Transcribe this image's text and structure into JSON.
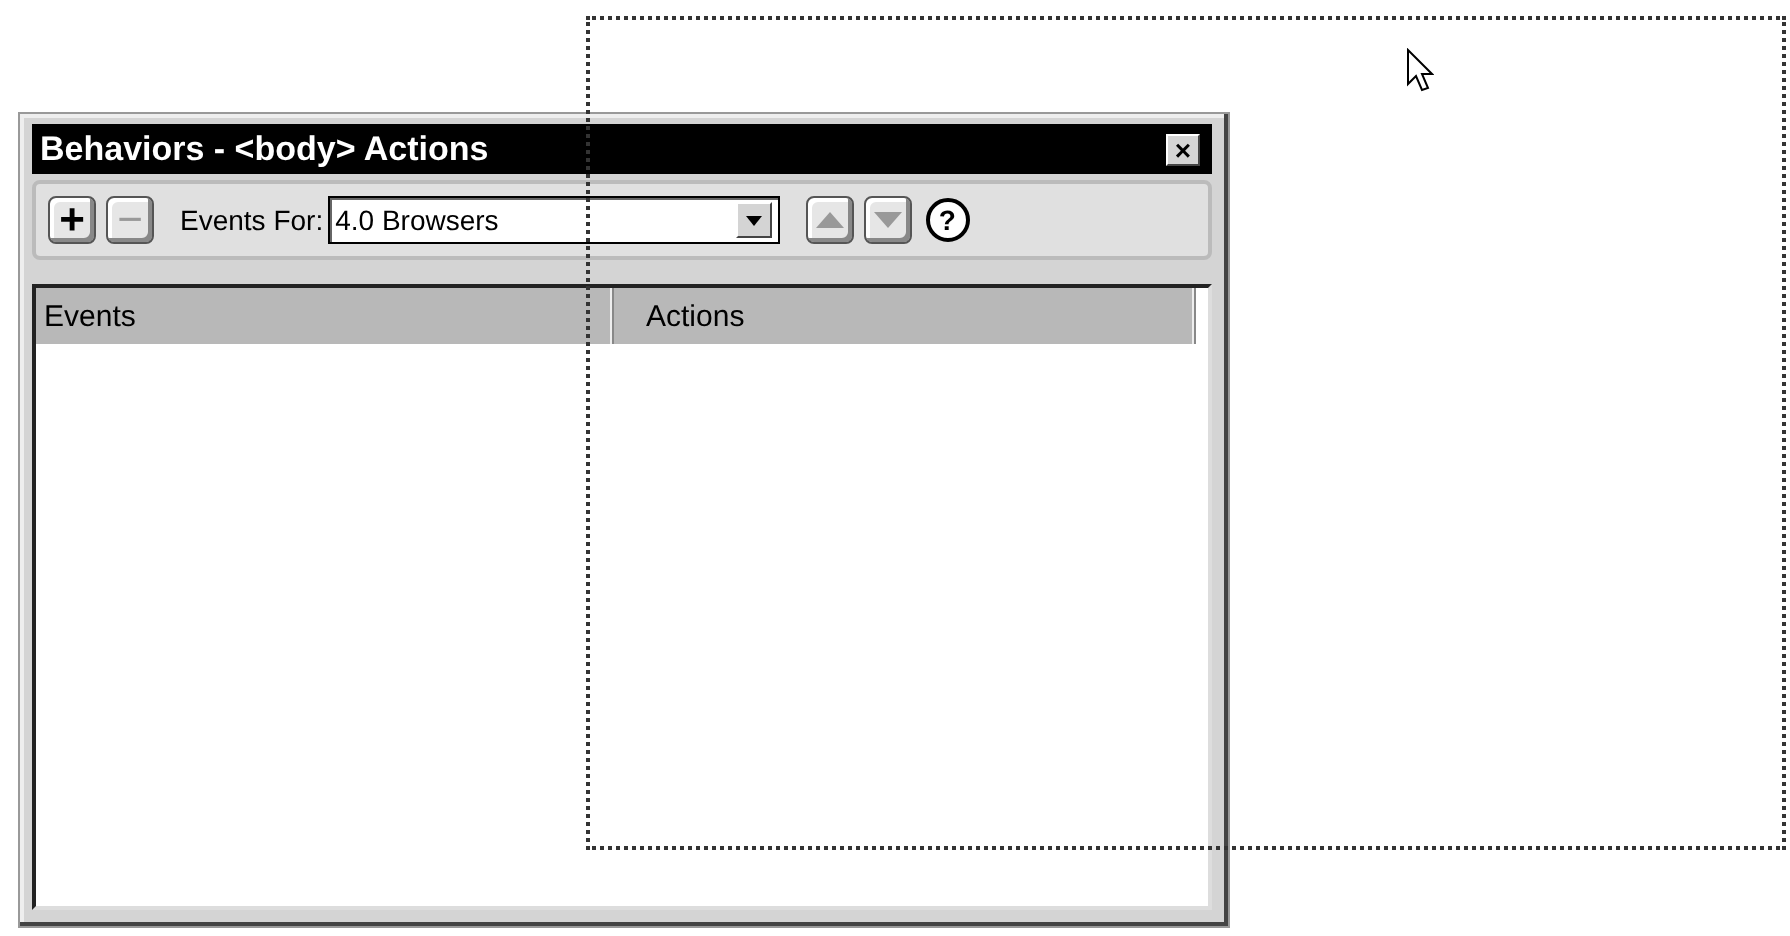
{
  "window": {
    "title": "Behaviors - <body> Actions",
    "close": "×"
  },
  "toolbar": {
    "add": "+",
    "remove": "−",
    "events_for_label": "Events For:",
    "events_for_value": "4.0 Browsers",
    "help": "?"
  },
  "table": {
    "columns": [
      "Events",
      "Actions"
    ]
  }
}
